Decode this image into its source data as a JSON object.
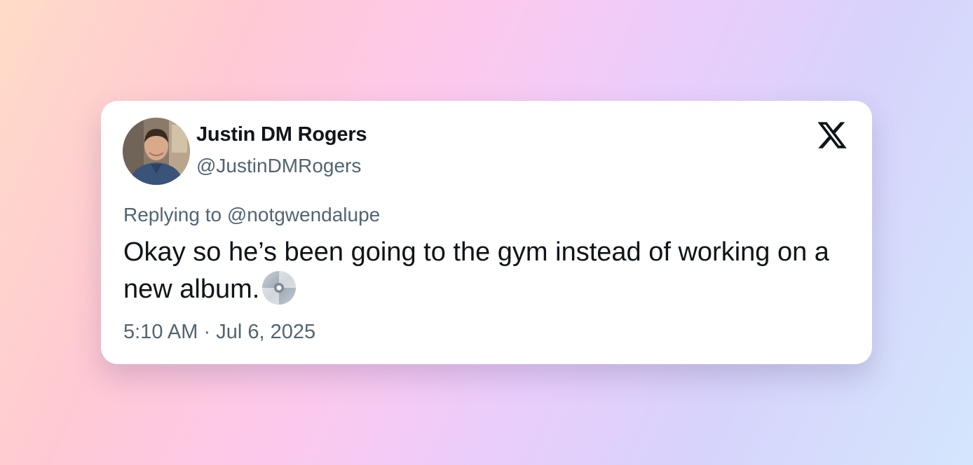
{
  "tweet": {
    "author_name": "Justin DM Rogers",
    "author_handle": "@JustinDMRogers",
    "reply_prefix": "Replying to",
    "reply_to": "@notgwendalupe",
    "text": "Okay so he’s been going to the gym instead of working on a new album.",
    "emoji_icon": "cd-disc-icon",
    "time": "5:10 AM",
    "separator": "·",
    "date": "Jul 6, 2025",
    "platform_logo": "x-logo-icon"
  },
  "colors": {
    "text_primary": "#0f1419",
    "text_secondary": "#536471",
    "card_background": "#ffffff"
  }
}
